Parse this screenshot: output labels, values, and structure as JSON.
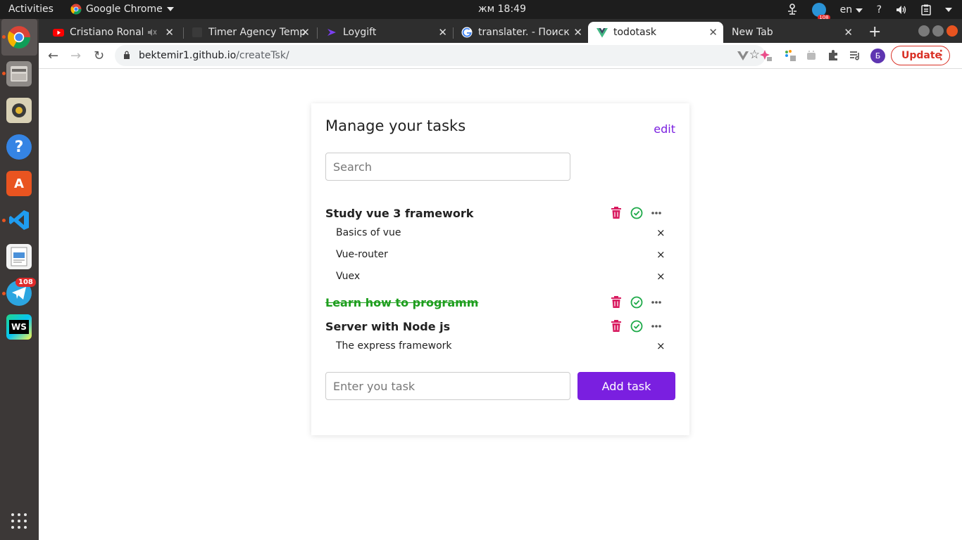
{
  "topbar": {
    "activities": "Activities",
    "app_name": "Google Chrome",
    "clock": "жм 18:49",
    "lang": "en",
    "help": "?",
    "tray_badge": "108"
  },
  "dock": {
    "telegram_badge": "108",
    "webstorm_label": "WS"
  },
  "tabs": [
    {
      "label": "Cristiano Ronal",
      "icon": "youtube-icon"
    },
    {
      "label": "Timer Agency Temp",
      "icon": "page-icon"
    },
    {
      "label": "Loygift",
      "icon": "loygift-icon"
    },
    {
      "label": "translater. - Поиск",
      "icon": "google-icon"
    },
    {
      "label": "todotask",
      "icon": "vue-icon"
    },
    {
      "label": "New Tab",
      "icon": ""
    }
  ],
  "toolbar": {
    "url_host": "bektemir1.github.io",
    "url_path": "/createTsk/",
    "profile_initial": "Б",
    "update_label": "Update"
  },
  "app": {
    "title": "Manage your tasks",
    "edit_label": "edit",
    "search_placeholder": "Search",
    "tasks": [
      {
        "title": "Study vue 3 framework",
        "done": false,
        "subtasks": [
          "Basics of vue",
          "Vue-router",
          "Vuex"
        ]
      },
      {
        "title": "Learn how to programm",
        "done": true,
        "subtasks": []
      },
      {
        "title": "Server with Node js",
        "done": false,
        "subtasks": [
          "The express framework"
        ]
      }
    ],
    "new_task_placeholder": "Enter you task",
    "add_task_label": "Add task",
    "remove_symbol": "×"
  },
  "colors": {
    "accent": "#7a1fe0",
    "delete": "#d81b60",
    "complete": "#1faa4a",
    "done_text": "#1e9e1e"
  }
}
